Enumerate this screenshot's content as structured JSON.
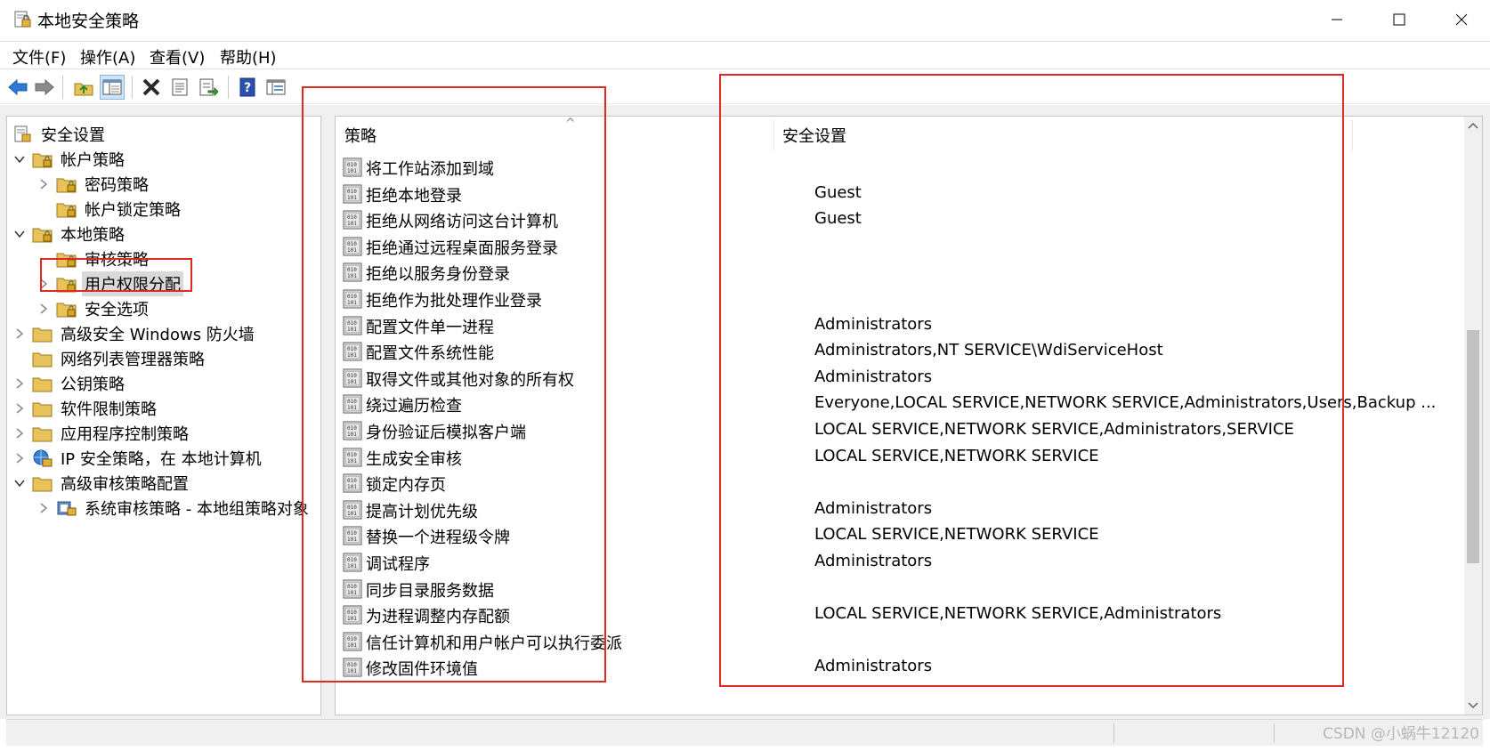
{
  "window": {
    "title": "本地安全策略",
    "controls": {
      "minimize": "minimize-icon",
      "maximize": "maximize-icon",
      "close": "close-icon"
    }
  },
  "menubar": {
    "items": [
      "文件(F)",
      "操作(A)",
      "查看(V)",
      "帮助(H)"
    ]
  },
  "toolbar": {
    "buttons": [
      "back-arrow-icon",
      "forward-arrow-icon",
      "up-folder-icon",
      "show-hide-tree-icon",
      "delete-icon",
      "properties-icon",
      "export-list-icon",
      "help-icon",
      "console-view-icon"
    ]
  },
  "tree": {
    "root": "安全设置",
    "nodes": [
      {
        "label": "帐户策略",
        "expanded": true
      },
      {
        "label": "密码策略"
      },
      {
        "label": "帐户锁定策略"
      },
      {
        "label": "本地策略",
        "expanded": true
      },
      {
        "label": "审核策略"
      },
      {
        "label": "用户权限分配",
        "selected": true
      },
      {
        "label": "安全选项"
      },
      {
        "label": "高级安全 Windows 防火墙"
      },
      {
        "label": "网络列表管理器策略"
      },
      {
        "label": "公钥策略"
      },
      {
        "label": "软件限制策略"
      },
      {
        "label": "应用程序控制策略"
      },
      {
        "label": "IP 安全策略，在 本地计算机"
      },
      {
        "label": "高级审核策略配置",
        "expanded": true
      },
      {
        "label": "系统审核策略 - 本地组策略对象"
      }
    ]
  },
  "list": {
    "columns": [
      "策略",
      "安全设置"
    ],
    "rows": [
      {
        "policy": "将工作站添加到域",
        "setting": ""
      },
      {
        "policy": "拒绝本地登录",
        "setting": "Guest"
      },
      {
        "policy": "拒绝从网络访问这台计算机",
        "setting": "Guest"
      },
      {
        "policy": "拒绝通过远程桌面服务登录",
        "setting": ""
      },
      {
        "policy": "拒绝以服务身份登录",
        "setting": ""
      },
      {
        "policy": "拒绝作为批处理作业登录",
        "setting": ""
      },
      {
        "policy": "配置文件单一进程",
        "setting": "Administrators"
      },
      {
        "policy": "配置文件系统性能",
        "setting": "Administrators,NT SERVICE\\WdiServiceHost"
      },
      {
        "policy": "取得文件或其他对象的所有权",
        "setting": "Administrators"
      },
      {
        "policy": "绕过遍历检查",
        "setting": "Everyone,LOCAL SERVICE,NETWORK SERVICE,Administrators,Users,Backup ..."
      },
      {
        "policy": "身份验证后模拟客户端",
        "setting": "LOCAL SERVICE,NETWORK SERVICE,Administrators,SERVICE"
      },
      {
        "policy": "生成安全审核",
        "setting": "LOCAL SERVICE,NETWORK SERVICE"
      },
      {
        "policy": "锁定内存页",
        "setting": ""
      },
      {
        "policy": "提高计划优先级",
        "setting": "Administrators"
      },
      {
        "policy": "替换一个进程级令牌",
        "setting": "LOCAL SERVICE,NETWORK SERVICE"
      },
      {
        "policy": "调试程序",
        "setting": "Administrators"
      },
      {
        "policy": "同步目录服务数据",
        "setting": ""
      },
      {
        "policy": "为进程调整内存配额",
        "setting": "LOCAL SERVICE,NETWORK SERVICE,Administrators"
      },
      {
        "policy": "信任计算机和用户帐户可以执行委派",
        "setting": ""
      },
      {
        "policy": "修改固件环境值",
        "setting": "Administrators"
      }
    ]
  },
  "watermark": "CSDN @小蜗牛12120",
  "colors": {
    "annotation": "#e02a1f",
    "folder": "#e8c25a",
    "selection": "#d9d9d9"
  }
}
